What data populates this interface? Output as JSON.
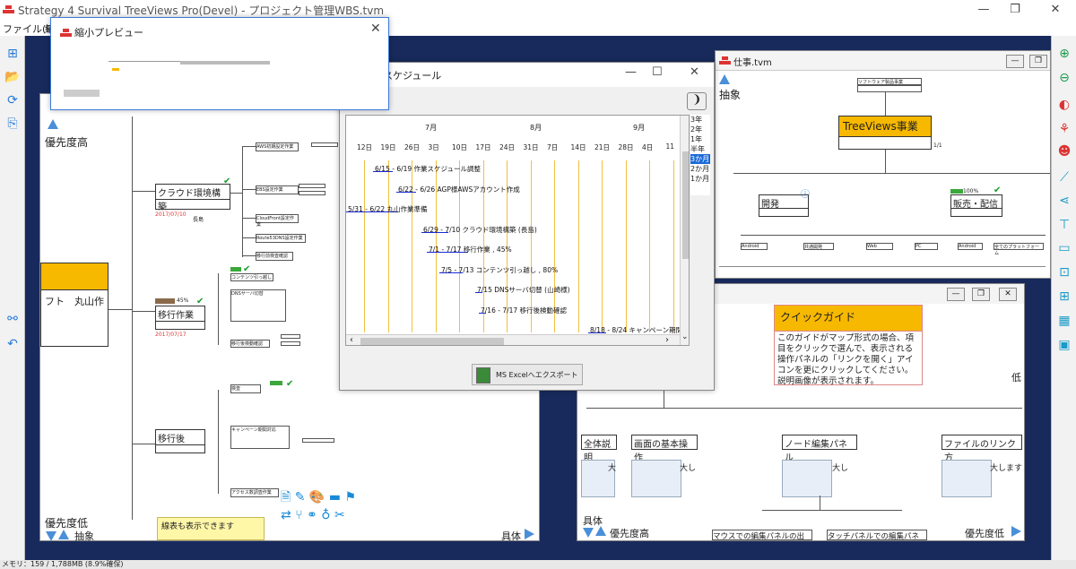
{
  "app": {
    "title": "Strategy 4 Survival TreeViews Pro(Devel) - プロジェクト管理WBS.tvm",
    "menu": [
      "ファイル(F)",
      "編"
    ],
    "status": "メモリ：159 / 1,788MB (8.9%確保)"
  },
  "preview": {
    "title": "縮小プレビュー"
  },
  "schedule": {
    "title": "スケジュール",
    "months": [
      "7月",
      "8月",
      "9月"
    ],
    "days": [
      "12日",
      "19日",
      "26日",
      "3日",
      "10日",
      "17日",
      "24日",
      "31日",
      "7日",
      "14日",
      "21日",
      "28日",
      "4日",
      "11"
    ],
    "ranges": [
      "3年",
      "2年",
      "1年",
      "半年",
      "3か月",
      "2か月",
      "1か月"
    ],
    "selected_range": "3か月",
    "items": [
      "6/15 - 6/19  作業スケジュール調整",
      "6/22 - 6/26  AGP様AWSアカウント作成",
      "5/31 - 6/22  丸山作業準備",
      "6/29 - 7/10  クラウド環境構築 (長島)",
      "7/1 - 7/17  移行作業 , 45%",
      "7/5 - 7/13  コンテンツ引っ越し , 80%",
      "7/15 DNSサーバ切替 (山崎様)",
      "7/16 - 7/17  移行後検動確認",
      "8/18 - 8/24  キャンペーン期間"
    ],
    "export_button": "MS Excelへエクスポート",
    "toggle_label": "❩"
  },
  "wbs": {
    "priority_high": "優先度高",
    "priority_low": "優先度低",
    "abstract": "抽象",
    "concrete": "具体",
    "root_text": "フト　丸山作",
    "node1": "クラウド環境構築",
    "node1_date": "2017/07/10",
    "node1_sub": "長島",
    "node2": "移行作業",
    "node2_date": "2017/07/17",
    "node2_pct": "45%",
    "node3": "移行後",
    "note": "線表も表示できます",
    "sub_cloud": [
      "AWS初期設定作業",
      "EBS設定作業",
      "CloudFront設定作業",
      "Route53DNS設定作業",
      "移行前検査確認"
    ],
    "sub_move": [
      "コンテンツ引っ越し",
      "DNSサーバ切替",
      "移行後検動確認"
    ],
    "sub_after": [
      "検査",
      "キャンペーン期間対応",
      "アクセス数調査作業"
    ]
  },
  "work": {
    "title": "仕事.tvm",
    "abstract": "抽象",
    "root": "TreeViews事業",
    "root_top": "ソフトウェア製品事業",
    "root_ratio": "1/1",
    "dev": "開発",
    "sales": "販売・配信",
    "sales_pct": "100%",
    "children": [
      "Android",
      "共通開発",
      "Web",
      "PC",
      "Android",
      "全てのプラットフォーム"
    ]
  },
  "guide": {
    "title": "クイックガイド",
    "text": "このガイドがマップ形式の場合、項目をクリックで選んで、表示される操作パネルの「リンクを開く」アイコンを更にクリックしてください。説明画像が表示されます。",
    "priority_low_right": "低",
    "branches": [
      "全体説明",
      "画面の基本操作",
      "ノード編集パネル",
      "ファイルのリンク方"
    ],
    "branch_sub": [
      "大",
      "大し",
      "大し",
      "大します"
    ],
    "concrete": "具体",
    "priority_high": "優先度高",
    "priority_low": "優先度低",
    "bottom_nodes": [
      "マウスでの編集パネルの出",
      "タッチパネルでの編集パネ"
    ]
  },
  "colors": {
    "accent": "#f7b800",
    "desktop": "#182a5c",
    "arrow": "#1a2bd6",
    "check": "#1a9a2a",
    "logo": "#dd3333"
  }
}
